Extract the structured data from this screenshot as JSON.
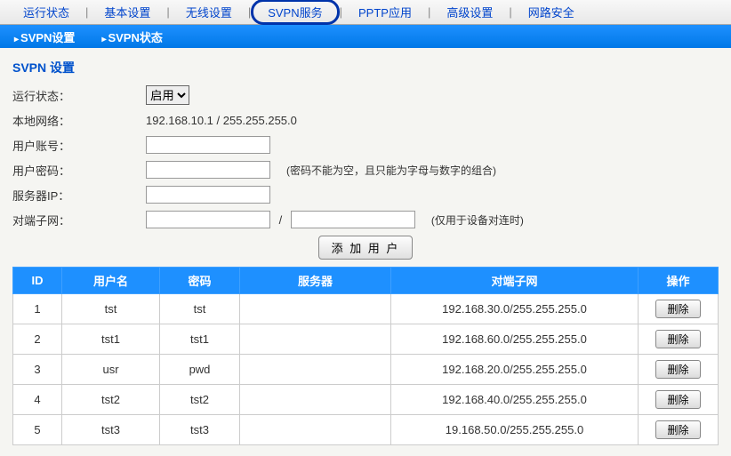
{
  "topnav": {
    "items": [
      "运行状态",
      "基本设置",
      "无线设置",
      "SVPN服务",
      "PPTP应用",
      "高级设置",
      "网路安全"
    ],
    "highlighted_index": 3
  },
  "subnav": {
    "items": [
      "SVPN设置",
      "SVPN状态"
    ]
  },
  "page": {
    "title": "SVPN 设置"
  },
  "form": {
    "status_label": "运行状态",
    "status_option": "启用",
    "local_net_label": "本地网络",
    "local_net_value": "192.168.10.1 / 255.255.255.0",
    "user_label": "用户账号",
    "pwd_label": "用户密码",
    "pwd_hint": "(密码不能为空，且只能为字母与数字的组合)",
    "server_ip_label": "服务器IP",
    "peer_net_label": "对端子网",
    "peer_net_hint": "(仅用于设备对连时)",
    "add_button": "添 加 用 户"
  },
  "table": {
    "headers": {
      "id": "ID",
      "user": "用户名",
      "pwd": "密码",
      "server": "服务器",
      "peer": "对端子网",
      "op": "操作"
    },
    "delete_label": "删除",
    "rows": [
      {
        "id": "1",
        "user": "tst",
        "pwd": "tst",
        "server": "",
        "peer": "192.168.30.0/255.255.255.0"
      },
      {
        "id": "2",
        "user": "tst1",
        "pwd": "tst1",
        "server": "",
        "peer": "192.168.60.0/255.255.255.0"
      },
      {
        "id": "3",
        "user": "usr",
        "pwd": "pwd",
        "server": "",
        "peer": "192.168.20.0/255.255.255.0"
      },
      {
        "id": "4",
        "user": "tst2",
        "pwd": "tst2",
        "server": "",
        "peer": "192.168.40.0/255.255.255.0"
      },
      {
        "id": "5",
        "user": "tst3",
        "pwd": "tst3",
        "server": "",
        "peer": "19.168.50.0/255.255.255.0"
      }
    ]
  }
}
